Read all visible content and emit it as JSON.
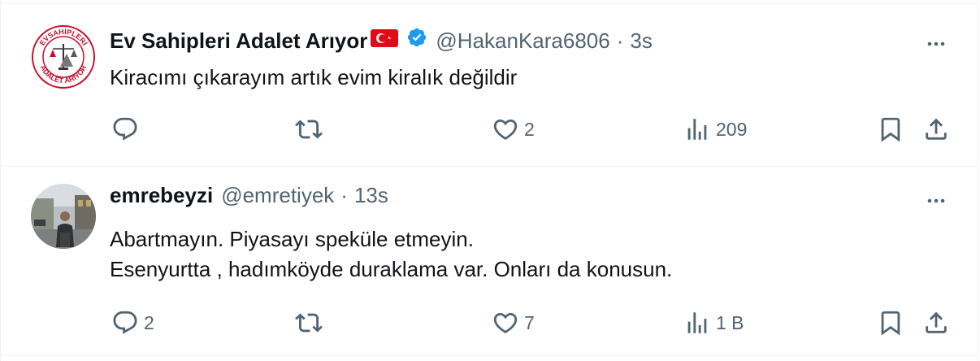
{
  "colors": {
    "text_primary": "#0f1419",
    "text_secondary": "#536471",
    "verified_blue": "#1d9bf0",
    "border": "#eff3f4",
    "flag_red": "#e30a17"
  },
  "tweets": [
    {
      "author_name": "Ev Sahipleri Adalet Arıyor",
      "flag_icon": "turkey-flag-icon",
      "verified": true,
      "handle": "@HakanKara6806",
      "separator": "·",
      "time": "3s",
      "text_lines": [
        "Kiracımı çıkarayım artık evim kiralık değildir"
      ],
      "avatar": {
        "text_top": "EVSAHİPLERİ",
        "text_bottom": "ADALET ARIYOR",
        "icon": "scales-of-justice-icon"
      },
      "reply_count": "",
      "retweet_count": "",
      "like_count": "2",
      "view_count": "209"
    },
    {
      "author_name": "emrebeyzi",
      "verified": false,
      "handle": "@emretiyek",
      "separator": "·",
      "time": "13s",
      "text_lines": [
        "Abartmayın. Piyasayı spekülе etmeyin.",
        "Esenyurtta , hadımköyde duraklama var. Onları da konusun."
      ],
      "avatar": {
        "icon": "profile-photo"
      },
      "reply_count": "2",
      "retweet_count": "",
      "like_count": "7",
      "view_count": "1 B"
    }
  ]
}
